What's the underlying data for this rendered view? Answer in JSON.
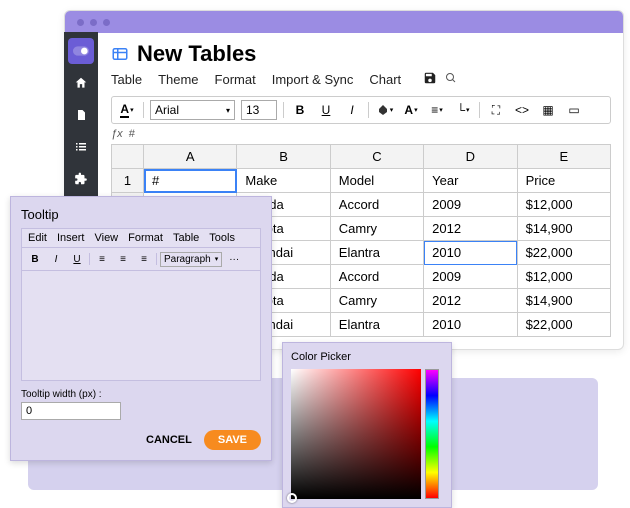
{
  "title": "New Tables",
  "menubar": [
    "Table",
    "Theme",
    "Format",
    "Import & Sync",
    "Chart"
  ],
  "toolbar": {
    "font": "Arial",
    "size": "13"
  },
  "fx_value": "#",
  "columns": [
    "A",
    "B",
    "C",
    "D",
    "E"
  ],
  "rows": [
    {
      "n": "1",
      "a": "#",
      "b": "Make",
      "c": "Model",
      "d": "Year",
      "e": "Price"
    },
    {
      "n": "",
      "a": "",
      "b": "Honda",
      "c": "Accord",
      "d": "2009",
      "e": "$12,000"
    },
    {
      "n": "",
      "a": "",
      "b": "Toyota",
      "c": "Camry",
      "d": "2012",
      "e": "$14,900"
    },
    {
      "n": "",
      "a": "",
      "b": "Hyundai",
      "c": "Elantra",
      "d": "2010",
      "e": "$22,000"
    },
    {
      "n": "",
      "a": "",
      "b": "Honda",
      "c": "Accord",
      "d": "2009",
      "e": "$12,000"
    },
    {
      "n": "",
      "a": "",
      "b": "Toyota",
      "c": "Camry",
      "d": "2012",
      "e": "$14,900"
    },
    {
      "n": "",
      "a": "",
      "b": "Hyundai",
      "c": "Elantra",
      "d": "2010",
      "e": "$22,000"
    }
  ],
  "tooltip": {
    "title": "Tooltip",
    "menu": [
      "Edit",
      "Insert",
      "View",
      "Format",
      "Table",
      "Tools"
    ],
    "paragraph_label": "Paragraph",
    "width_label": "Tooltip width (px) :",
    "width_value": "0",
    "cancel": "CANCEL",
    "save": "SAVE"
  },
  "color_picker": {
    "title": "Color Picker"
  }
}
